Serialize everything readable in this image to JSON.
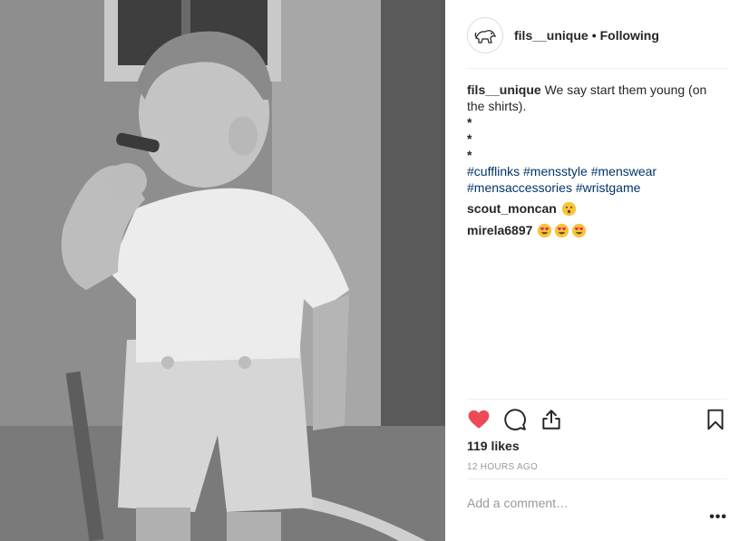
{
  "post": {
    "image_alt": "Black and white photo of a young boy smoking a cigar",
    "author": "fils__unique",
    "separator": "•",
    "follow_status": "Following",
    "caption": {
      "user": "fils__unique",
      "text": "We say start them young (on the shirts).",
      "star_lines": [
        "*",
        "*",
        "*"
      ],
      "hashtags": [
        "#cufflinks",
        "#mensstyle",
        "#menswear",
        "#mensaccessories",
        "#wristgame"
      ]
    },
    "comments": [
      {
        "user": "scout_moncan",
        "emojis": [
          "hushed-face"
        ]
      },
      {
        "user": "mirela6897",
        "emojis": [
          "heart-eyes",
          "heart-eyes",
          "heart-eyes"
        ]
      }
    ],
    "likes": "119 likes",
    "timestamp": "12 HOURS AGO",
    "comment_input": {
      "placeholder": "Add a comment…",
      "value": ""
    },
    "more_options": "•••",
    "icons": {
      "like": "heart-icon",
      "comment": "comment-icon",
      "share": "share-icon",
      "save": "bookmark-icon",
      "like_color": "#ed4956"
    }
  }
}
